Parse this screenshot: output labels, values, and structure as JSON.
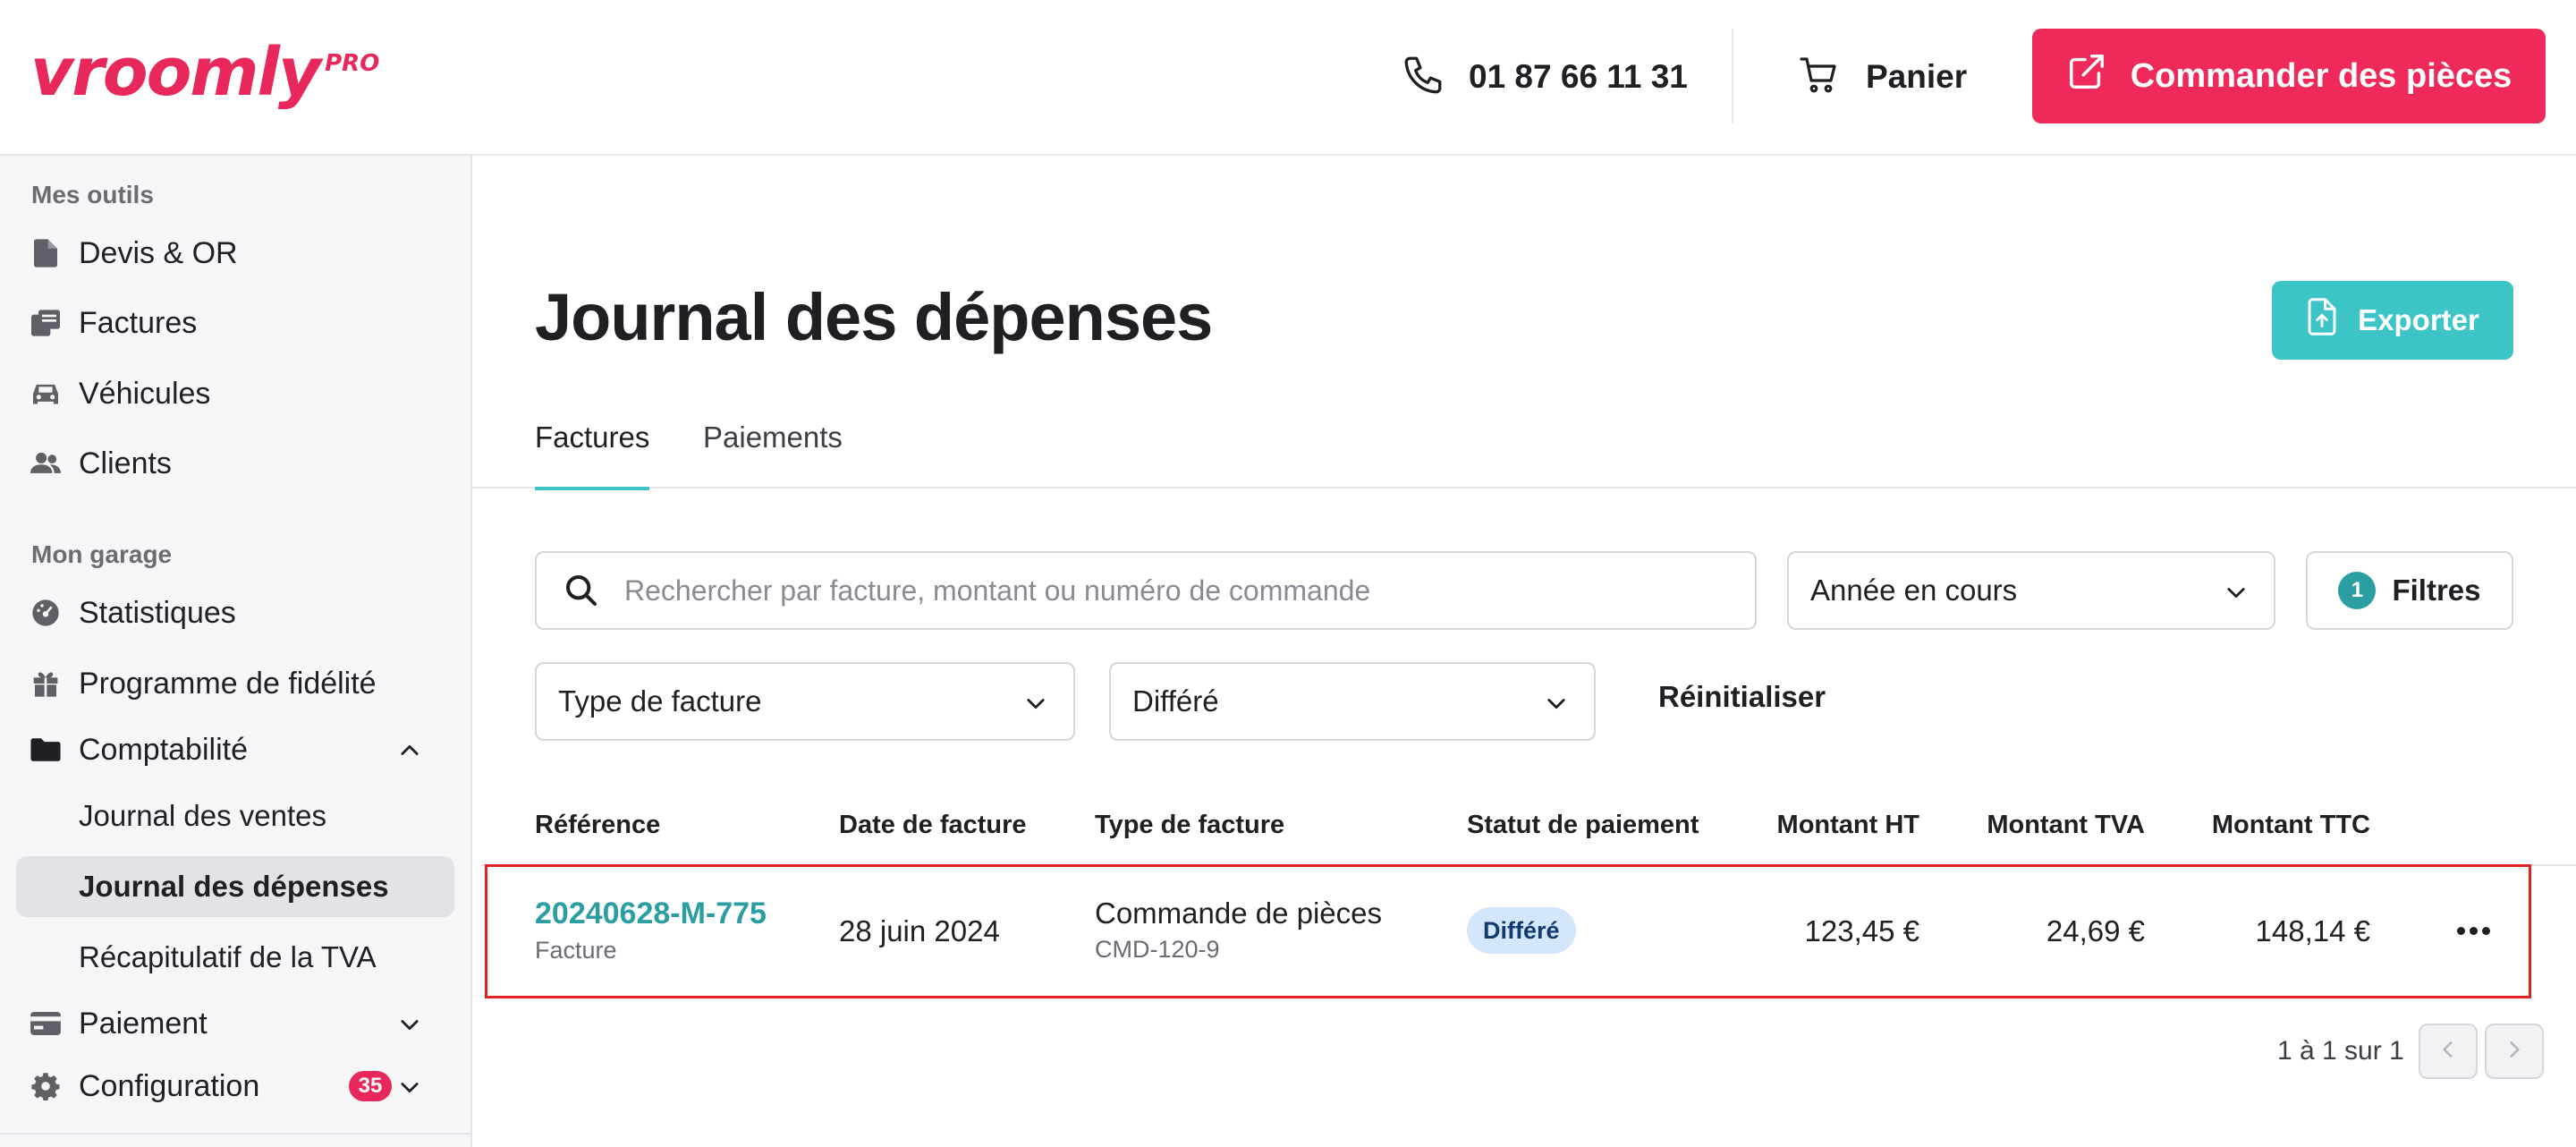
{
  "header": {
    "logo_text": "vroomly",
    "logo_suffix": "PRO",
    "phone": "01 87 66 11 31",
    "cart_label": "Panier",
    "order_button": "Commander des pièces"
  },
  "sidebar": {
    "section_tools": "Mes outils",
    "tools": [
      {
        "label": "Devis & OR",
        "icon": "document-icon"
      },
      {
        "label": "Factures",
        "icon": "invoice-icon"
      },
      {
        "label": "Véhicules",
        "icon": "car-icon"
      },
      {
        "label": "Clients",
        "icon": "users-icon"
      }
    ],
    "section_garage": "Mon garage",
    "garage": [
      {
        "label": "Statistiques",
        "icon": "gauge-icon"
      },
      {
        "label": "Programme de fidélité",
        "icon": "gift-icon"
      },
      {
        "label": "Comptabilité",
        "icon": "folder-icon",
        "expanded": true
      }
    ],
    "accounting_sub": [
      {
        "label": "Journal des ventes"
      },
      {
        "label": "Journal des dépenses",
        "active": true
      },
      {
        "label": "Récapitulatif de la TVA"
      }
    ],
    "payment": {
      "label": "Paiement",
      "icon": "card-icon"
    },
    "configuration": {
      "label": "Configuration",
      "icon": "gear-icon",
      "badge": "35"
    }
  },
  "main": {
    "title": "Journal des dépenses",
    "export_button": "Exporter",
    "tabs": [
      {
        "label": "Factures",
        "active": true
      },
      {
        "label": "Paiements",
        "active": false
      }
    ],
    "search_placeholder": "Rechercher par facture, montant ou numéro de commande",
    "year_select": "Année en cours",
    "filters_count": "1",
    "filters_label": "Filtres",
    "invoice_type_select": "Type de facture",
    "payment_status_select": "Différé",
    "reset_label": "Réinitialiser"
  },
  "table": {
    "columns": [
      "Référence",
      "Date de facture",
      "Type de facture",
      "Statut de paiement",
      "Montant HT",
      "Montant TVA",
      "Montant TTC"
    ],
    "rows": [
      {
        "reference": "20240628-M-775",
        "reference_sub": "Facture",
        "date": "28 juin 2024",
        "type": "Commande de pièces",
        "type_sub": "CMD-120-9",
        "status": "Différé",
        "ht": "123,45 €",
        "tva": "24,69 €",
        "ttc": "148,14 €"
      }
    ],
    "pagination": "1 à 1 sur 1"
  },
  "colors": {
    "brand_pink": "#ef2a5b",
    "teal": "#3cc4c6",
    "teal_dark": "#2b9ea2",
    "highlight_border": "#e02424",
    "status_bg": "#d4e6fb"
  }
}
